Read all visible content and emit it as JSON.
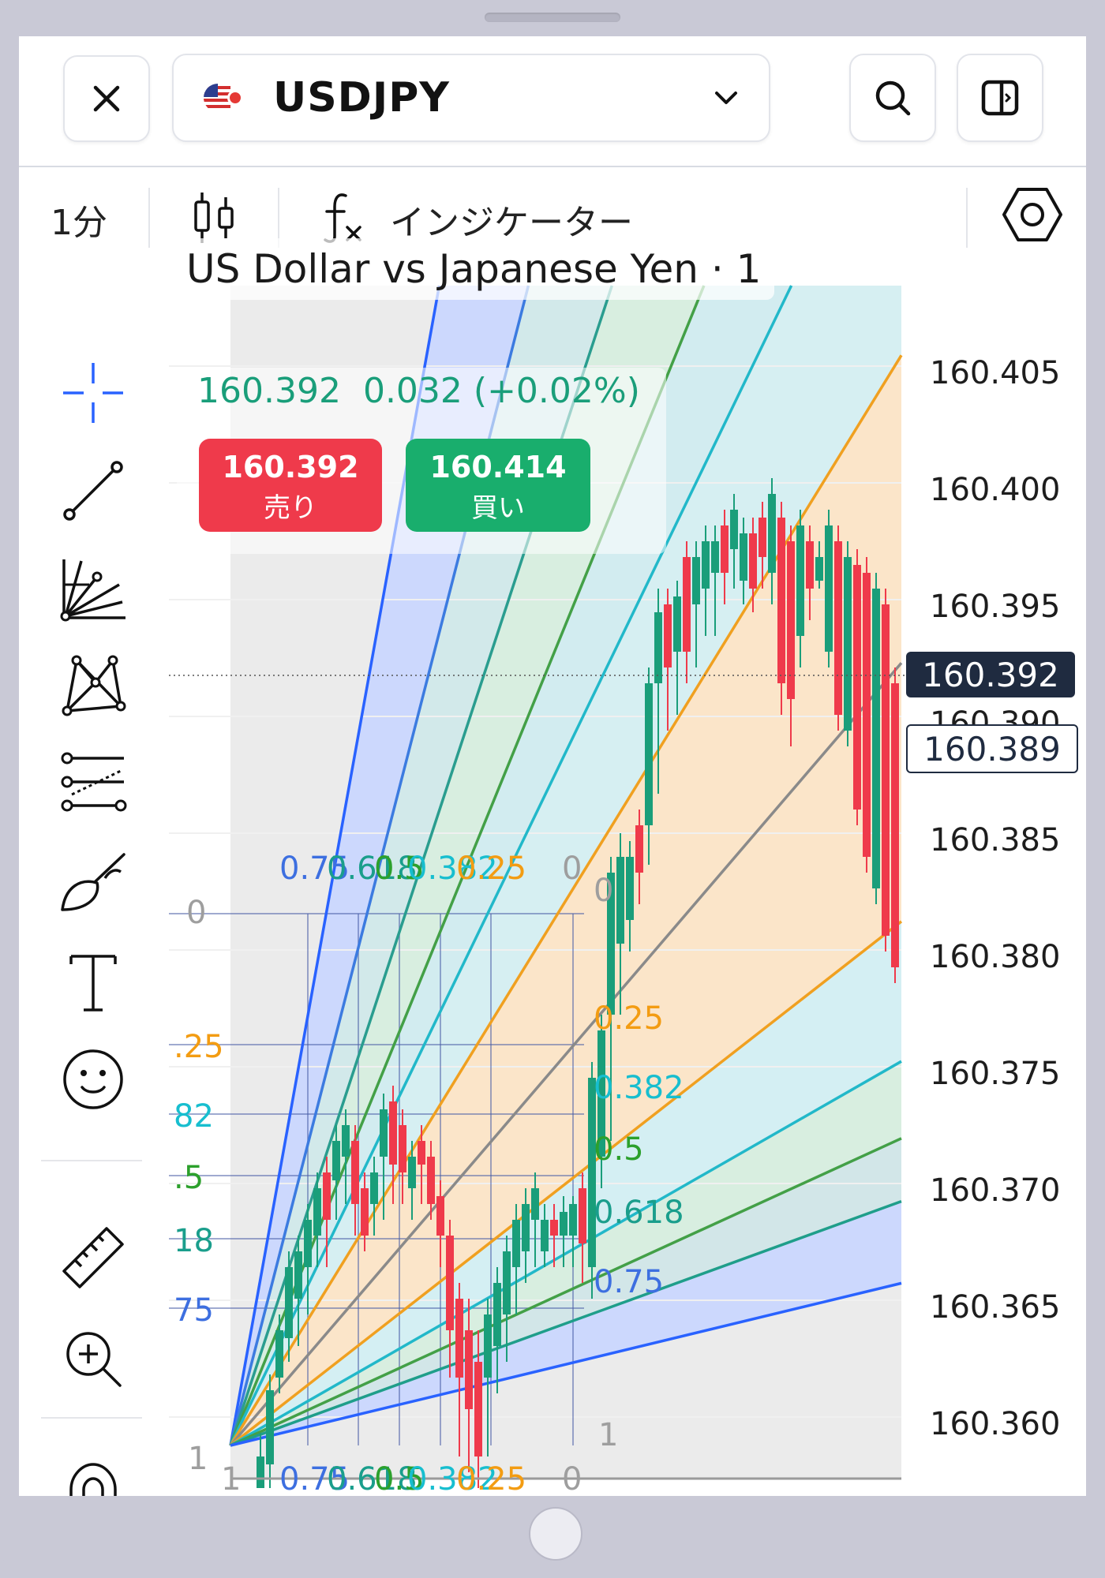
{
  "header": {
    "symbol": "USDJPY"
  },
  "toolbar": {
    "timeframe": "1分",
    "indicators_label": "インジケーター"
  },
  "legend": {
    "title": "US Dollar vs Japanese Yen · 1",
    "last_price": "160.392",
    "change": "0.032 (+0.02%)"
  },
  "trade": {
    "sell_price": "160.392",
    "sell_label": "売り",
    "buy_price": "160.414",
    "buy_label": "買い"
  },
  "yaxis": {
    "labels": [
      "160.405",
      "160.400",
      "160.395",
      "160.390",
      "160.385",
      "160.380",
      "160.375",
      "160.370",
      "160.365",
      "160.360"
    ],
    "current_price": "160.392",
    "crosshair_price": "160.389"
  },
  "fib_levels": {
    "right": [
      "0",
      "0.25",
      "0.382",
      "0.5",
      "0.618",
      "0.75",
      "1"
    ],
    "left_partial": [
      "0",
      ".25",
      "82",
      ".5",
      "18",
      "75",
      "1"
    ],
    "top_row": [
      "0.75",
      "0.618",
      "0.5",
      "0.382",
      "0.25",
      "0"
    ],
    "bottom_row": [
      "1",
      "0.75",
      "0.618",
      "0.5",
      "0.382",
      "0.25",
      "0"
    ]
  },
  "colors": {
    "sell": "#ef3a4b",
    "buy": "#19ae6d",
    "candle_up": "#1a9e7a",
    "candle_down": "#ef3a4b",
    "accent": "#2962ff",
    "price_tag": "#1f2b40"
  },
  "icons": {
    "close": "close-icon",
    "flag": "us-jp-flag-icon",
    "dropdown": "chevron-down-icon",
    "search": "search-icon",
    "layout": "layout-panel-icon",
    "chart_type": "candlestick-icon",
    "indicator": "fx-icon",
    "settings": "hexagon-settings-icon"
  }
}
